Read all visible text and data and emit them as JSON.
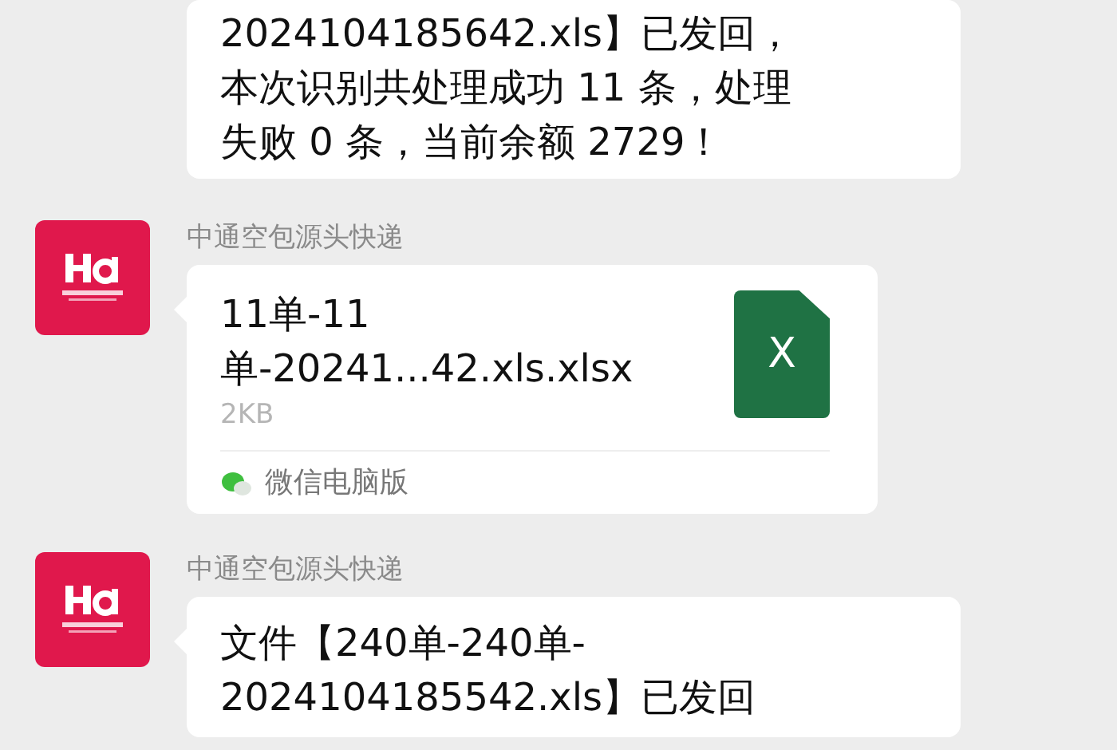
{
  "messages": [
    {
      "kind": "text",
      "lines": [
        "2024104185642.xls】已发回，",
        "本次识别共处理成功 11 条，处理",
        "失败 0 条，当前余额 2729！"
      ]
    },
    {
      "kind": "file",
      "sender": "中通空包源头快递",
      "file_name": [
        "11单-11",
        "单-20241...42.xls.xlsx"
      ],
      "size": "2KB",
      "file_icon_letter": "X",
      "source": "微信电脑版"
    },
    {
      "kind": "text",
      "sender": "中通空包源头快递",
      "lines": [
        "文件【240单-240单-",
        "2024104185542.xls】已发回"
      ]
    }
  ]
}
